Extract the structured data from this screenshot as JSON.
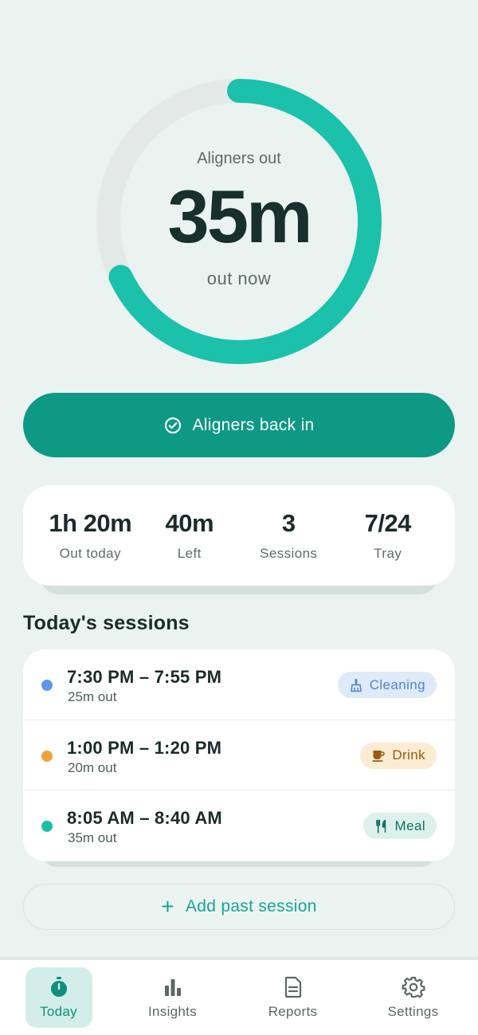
{
  "timer": {
    "label": "Aligners out",
    "value": "35m",
    "sub": "out now",
    "progress_fraction": 0.68
  },
  "primary_action": {
    "label": "Aligners back in",
    "icon": "check-circle-icon"
  },
  "stats": [
    {
      "value": "1h 20m",
      "label": "Out today"
    },
    {
      "value": "40m",
      "label": "Left"
    },
    {
      "value": "3",
      "label": "Sessions"
    },
    {
      "value": "7/24",
      "label": "Tray"
    }
  ],
  "sessions_title": "Today's sessions",
  "sessions": [
    {
      "time": "7:30 PM – 7:55 PM",
      "duration": "25m out",
      "tag": "Cleaning",
      "tag_icon": "brush-icon",
      "dot_color": "#5b97e6",
      "tag_bg": "#dfeaf8",
      "tag_color": "#4f86c9"
    },
    {
      "time": "1:00 PM – 1:20 PM",
      "duration": "20m out",
      "tag": "Drink",
      "tag_icon": "cup-icon",
      "dot_color": "#f0a23a",
      "tag_bg": "#fbecd3",
      "tag_color": "#9a5a12"
    },
    {
      "time": "8:05 AM – 8:40 AM",
      "duration": "35m out",
      "tag": "Meal",
      "tag_icon": "fork-knife-icon",
      "dot_color": "#1bbfa6",
      "tag_bg": "#dcf1ec",
      "tag_color": "#136f61"
    }
  ],
  "add_session": {
    "label": "Add past session",
    "icon": "plus-icon"
  },
  "nav": [
    {
      "label": "Today",
      "icon": "stopwatch-icon",
      "active": true
    },
    {
      "label": "Insights",
      "icon": "bar-chart-icon",
      "active": false
    },
    {
      "label": "Reports",
      "icon": "document-icon",
      "active": false
    },
    {
      "label": "Settings",
      "icon": "gear-icon",
      "active": false
    }
  ],
  "colors": {
    "accent": "#0e9985",
    "ring": "#1bc1aa",
    "ring_track": "#e2e9e7",
    "background": "#ebf3f1"
  }
}
